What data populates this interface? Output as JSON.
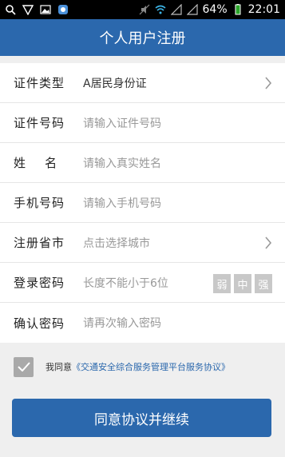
{
  "statusbar": {
    "battery_percent": "64%",
    "time": "22:01",
    "icons": [
      "search-icon",
      "shield-icon",
      "image-icon",
      "app-icon",
      "mute-icon",
      "wifi-icon",
      "signal-icon",
      "signal-icon-2",
      "battery-icon"
    ]
  },
  "header": {
    "title": "个人用户注册"
  },
  "form": {
    "rows": [
      {
        "label": "证件类型",
        "value": "A居民身份证"
      },
      {
        "label": "证件号码",
        "placeholder": "请输入证件号码"
      },
      {
        "label": "姓    名",
        "placeholder": "请输入真实姓名"
      },
      {
        "label": "手机号码",
        "placeholder": "请输入手机号码"
      },
      {
        "label": "注册省市",
        "placeholder": "点击选择城市"
      },
      {
        "label": "登录密码",
        "placeholder": "长度不能小于6位"
      },
      {
        "label": "确认密码",
        "placeholder": "请再次输入密码"
      }
    ],
    "strength": [
      "弱",
      "中",
      "强"
    ]
  },
  "agreement": {
    "checked": true,
    "prefix": "我同意",
    "link": "《交通安全综合服务管理平台服务协议》"
  },
  "submit": {
    "label": "同意协议并继续"
  },
  "colors": {
    "primary": "#2b68ad",
    "strength_bg": "#c8c8c8"
  }
}
